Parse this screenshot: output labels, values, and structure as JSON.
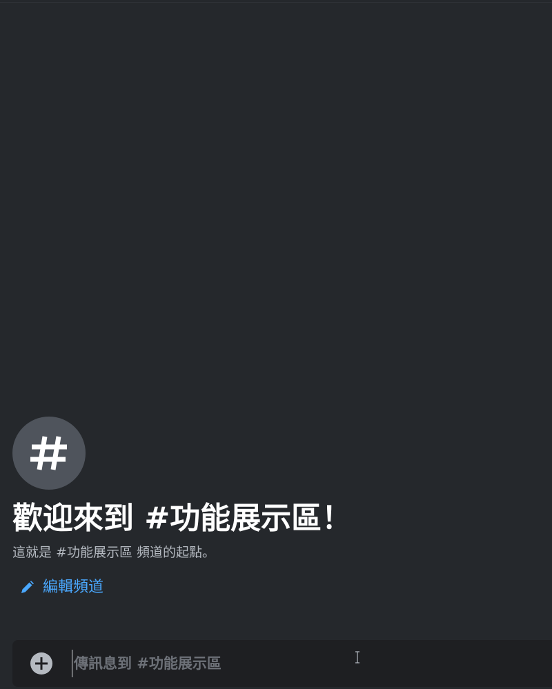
{
  "channel": {
    "avatar_icon": "hash-icon",
    "welcome_title": "歡迎來到 #功能展示區！",
    "welcome_subtitle": "這就是 #功能展示區 頻道的起點。",
    "edit_icon": "pencil-icon",
    "edit_label": "編輯頻道"
  },
  "composer": {
    "add_icon": "plus-circle-icon",
    "placeholder": "傳訊息到 #功能展示區",
    "value": ""
  },
  "colors": {
    "background": "#25282c",
    "composer_bg": "#1e1f22",
    "avatar_bg": "#4f545c",
    "title": "#ffffff",
    "subtitle": "#b5bac1",
    "link": "#4aa8ff"
  }
}
